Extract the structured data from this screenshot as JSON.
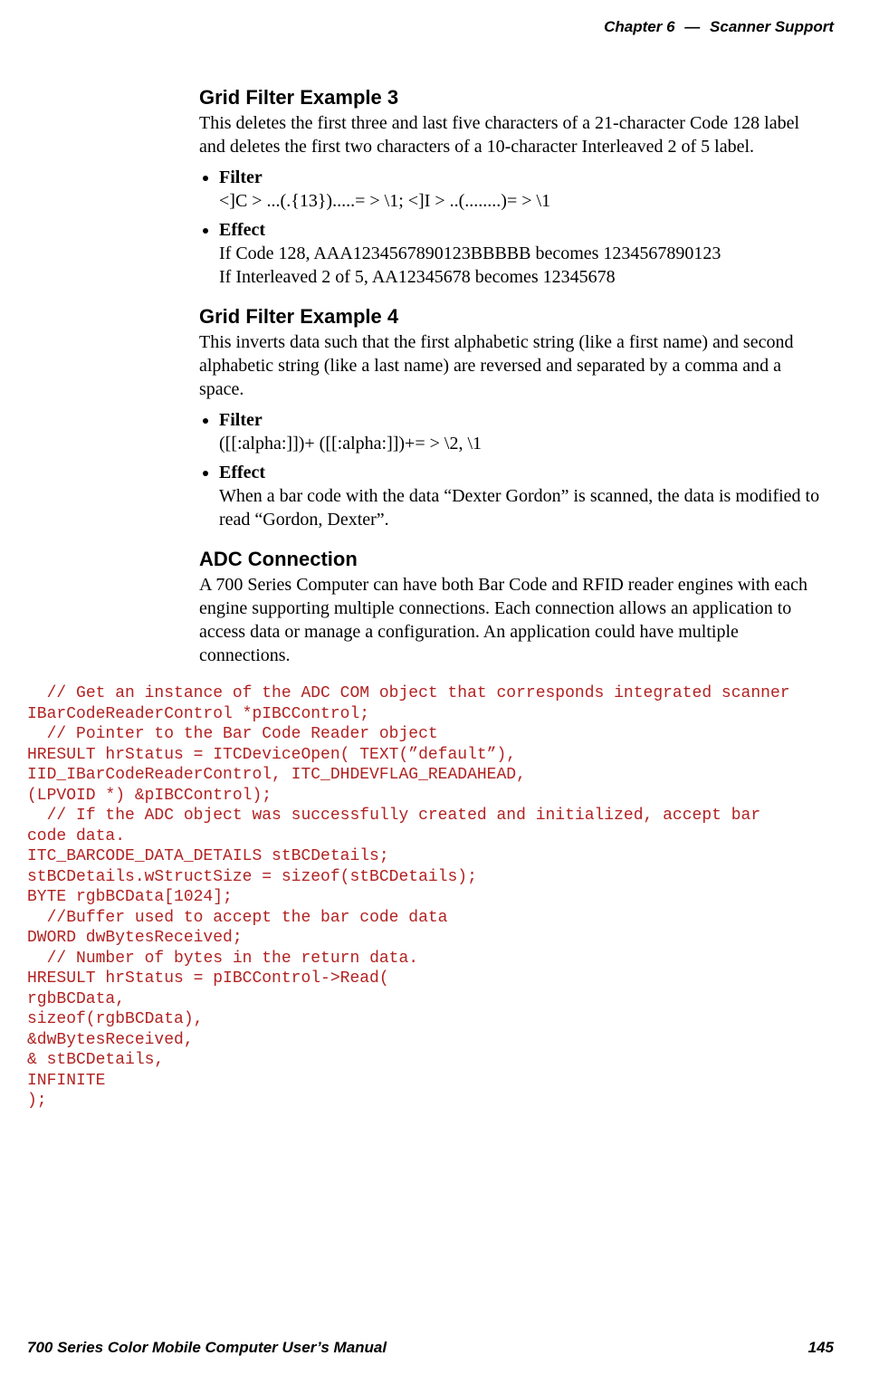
{
  "header": {
    "chapter": "Chapter  6",
    "dash": "—",
    "title": "Scanner Support"
  },
  "sections": {
    "ex3": {
      "heading": "Grid Filter Example 3",
      "para": "This deletes the first three and last five characters of a 21-character Code 128 label and deletes the first two characters of a 10-character Interleaved 2 of 5 label.",
      "filter_label": "Filter",
      "filter_text": "<]C > ...(.{13}).....= > \\1; <]I > ..(........)= > \\1",
      "effect_label": "Effect",
      "effect_line1": "If Code 128, AAA1234567890123BBBBB becomes 1234567890123",
      "effect_line2": "If Interleaved 2 of 5, AA12345678 becomes 12345678"
    },
    "ex4": {
      "heading": "Grid Filter Example 4",
      "para": "This inverts data such that the first alphabetic string (like a first name) and second alphabetic string (like a last name) are reversed and separated by a comma and a space.",
      "filter_label": "Filter",
      "filter_text": "([[:alpha:]])+ ([[:alpha:]])+= > \\2, \\1",
      "effect_label": "Effect",
      "effect_text": "When a bar code with the data “Dexter Gordon” is scanned, the data is modified to read “Gordon, Dexter”."
    },
    "adc": {
      "heading": "ADC Connection",
      "para": "A 700 Series Computer can have both Bar Code and RFID reader engines with each engine supporting multiple connections. Each connection allows an application to access data or manage a configuration. An application could have multiple connections."
    }
  },
  "code": "  // Get an instance of the ADC COM object that corresponds integrated scanner\nIBarCodeReaderControl *pIBCControl;\n  // Pointer to the Bar Code Reader object\nHRESULT hrStatus = ITCDeviceOpen( TEXT(”default”),\nIID_IBarCodeReaderControl, ITC_DHDEVFLAG_READAHEAD,\n(LPVOID *) &pIBCControl);\n  // If the ADC object was successfully created and initialized, accept bar\ncode data.\nITC_BARCODE_DATA_DETAILS stBCDetails;\nstBCDetails.wStructSize = sizeof(stBCDetails);\nBYTE rgbBCData[1024];\n  //Buffer used to accept the bar code data\nDWORD dwBytesReceived;\n  // Number of bytes in the return data.\nHRESULT hrStatus = pIBCControl->Read(\nrgbBCData,\nsizeof(rgbBCData),\n&dwBytesReceived,\n& stBCDetails,\nINFINITE\n);",
  "footer": {
    "manual": "700 Series Color Mobile Computer User’s Manual",
    "page": "145"
  }
}
